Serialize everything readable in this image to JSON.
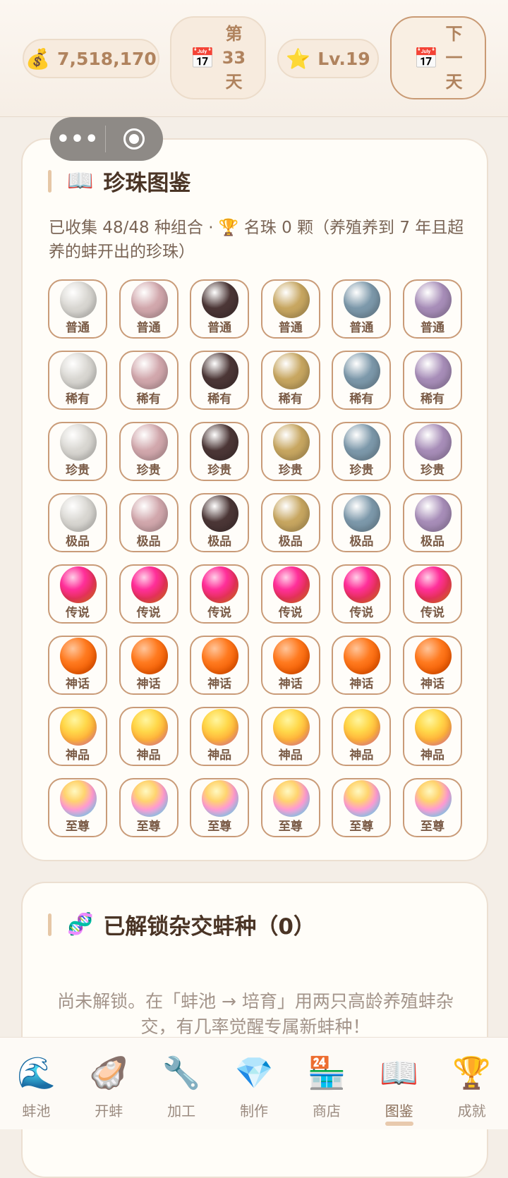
{
  "header": {
    "coins": "7,518,170",
    "day": [
      "第",
      "33",
      "天"
    ],
    "level": "Lv.19",
    "next_day": [
      "下",
      "一",
      "天"
    ]
  },
  "capsule": {
    "menu_glyph": "•••"
  },
  "encyclopedia": {
    "icon": "📖",
    "title": "珍珠图鉴",
    "desc": "已收集 48/48 种组合 · 🏆 名珠 0 颗（养殖养到 7 年且超养的蚌开出的珍珠）",
    "rows": [
      {
        "tier": "普通",
        "kind": "plain"
      },
      {
        "tier": "稀有",
        "kind": "plain"
      },
      {
        "tier": "珍贵",
        "kind": "plain"
      },
      {
        "tier": "极品",
        "kind": "plain"
      },
      {
        "tier": "传说",
        "kind": "legend"
      },
      {
        "tier": "神话",
        "kind": "myth"
      },
      {
        "tier": "神品",
        "kind": "divine"
      },
      {
        "tier": "至尊",
        "kind": "supreme"
      }
    ],
    "plain_colors": [
      "#d8d6d1",
      "#d1a7ac",
      "#4b3636",
      "#c7a660",
      "#7c98aa",
      "#a78db8"
    ]
  },
  "hybrid": {
    "icon": "🧬",
    "title": "已解锁杂交蚌种（0）",
    "empty_text": "尚未解锁。在「蚌池 → 培育」用两只高龄养殖蚌杂交，有几率觉醒专属新蚌种！"
  },
  "nav": [
    {
      "icon": "🌊",
      "label": "蚌池"
    },
    {
      "icon": "🦪",
      "label": "开蚌"
    },
    {
      "icon": "🔧",
      "label": "加工"
    },
    {
      "icon": "💎",
      "label": "制作"
    },
    {
      "icon": "🏪",
      "label": "商店"
    },
    {
      "icon": "📖",
      "label": "图鉴",
      "active": true
    },
    {
      "icon": "🏆",
      "label": "成就"
    }
  ]
}
